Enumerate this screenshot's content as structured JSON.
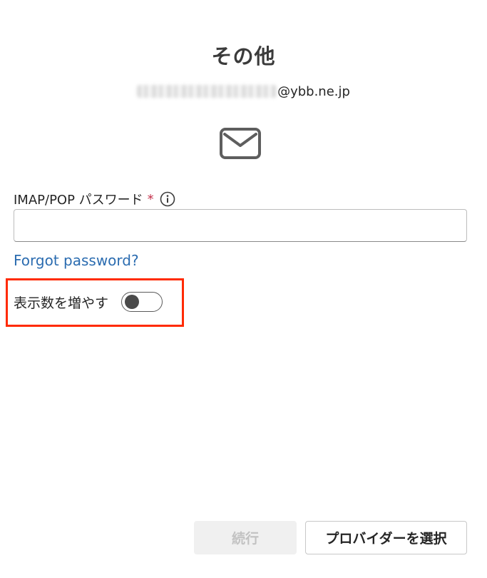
{
  "header": {
    "title": "その他",
    "email_domain": "@ybb.ne.jp"
  },
  "icons": {
    "mail": "envelope-icon",
    "info": "info-circle-icon"
  },
  "password_field": {
    "label": "IMAP/POP パスワード",
    "required_marker": "*",
    "value": "",
    "placeholder": ""
  },
  "links": {
    "forgot_password": "Forgot password?"
  },
  "more_options": {
    "label": "表示数を増やす",
    "toggle_state": "off"
  },
  "buttons": {
    "continue_label": "続行",
    "continue_enabled": false,
    "choose_provider_label": "プロバイダーを選択"
  },
  "colors": {
    "link": "#2b6cb0",
    "required": "#c4314b",
    "highlight": "#ff2a00",
    "disabled_button_bg": "#f0f0f0"
  }
}
